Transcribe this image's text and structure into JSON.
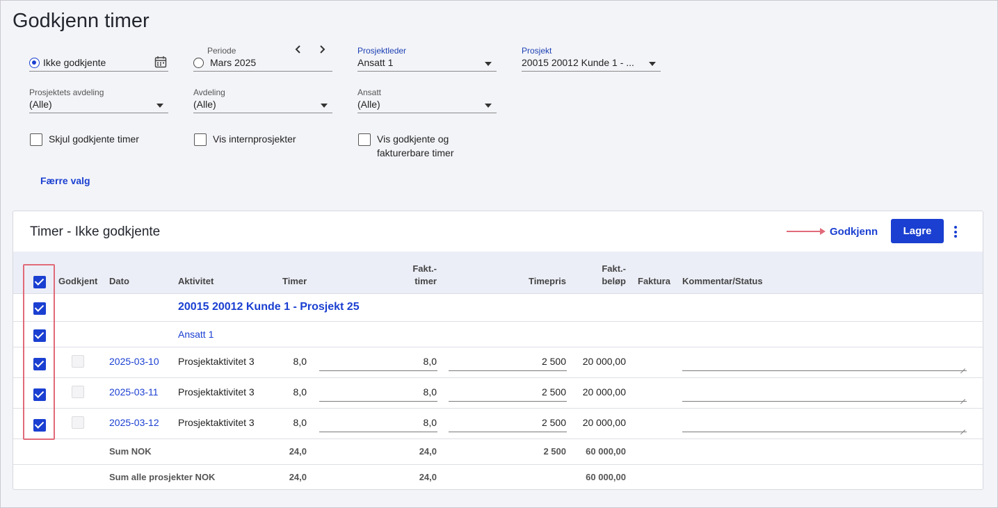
{
  "page": {
    "title": "Godkjenn timer"
  },
  "filters": {
    "status_option": "Ikke godkjente",
    "period": {
      "label": "Periode",
      "value": "Mars 2025"
    },
    "project_manager": {
      "label": "Prosjektleder",
      "value": "Ansatt 1"
    },
    "project": {
      "label": "Prosjekt",
      "value": "20015 20012 Kunde 1 - ..."
    },
    "project_department": {
      "label": "Prosjektets avdeling",
      "value": "(Alle)"
    },
    "department": {
      "label": "Avdeling",
      "value": "(Alle)"
    },
    "employee": {
      "label": "Ansatt",
      "value": "(Alle)"
    },
    "checkboxes": {
      "hide_approved": "Skjul godkjente timer",
      "show_internal": "Vis internprosjekter",
      "show_approved_billable_line1": "Vis godkjente og",
      "show_approved_billable_line2": "fakturerbare timer"
    },
    "fewer_options": "Færre valg"
  },
  "panel": {
    "title": "Timer - Ikke godkjente",
    "approve_label": "Godkjenn",
    "save_label": "Lagre"
  },
  "table": {
    "headers": {
      "approved": "Godkjent",
      "date": "Dato",
      "activity": "Aktivitet",
      "hours": "Timer",
      "billable_hours_1": "Fakt.-",
      "billable_hours_2": "timer",
      "rate": "Timepris",
      "billable_amount_1": "Fakt.-",
      "billable_amount_2": "beløp",
      "invoice": "Faktura",
      "comment": "Kommentar/Status"
    },
    "project_group": "20015 20012 Kunde 1 - Prosjekt 25",
    "employee_group": "Ansatt 1",
    "rows": [
      {
        "date": "2025-03-10",
        "activity": "Prosjektaktivitet 3",
        "hours": "8,0",
        "billable_hours": "8,0",
        "rate": "2 500",
        "amount": "20 000,00"
      },
      {
        "date": "2025-03-11",
        "activity": "Prosjektaktivitet 3",
        "hours": "8,0",
        "billable_hours": "8,0",
        "rate": "2 500",
        "amount": "20 000,00"
      },
      {
        "date": "2025-03-12",
        "activity": "Prosjektaktivitet 3",
        "hours": "8,0",
        "billable_hours": "8,0",
        "rate": "2 500",
        "amount": "20 000,00"
      }
    ],
    "sum": {
      "label": "Sum NOK",
      "hours": "24,0",
      "billable_hours": "24,0",
      "rate": "2 500",
      "amount": "60 000,00"
    },
    "sum_all": {
      "label": "Sum alle prosjekter NOK",
      "hours": "24,0",
      "billable_hours": "24,0",
      "amount": "60 000,00"
    }
  },
  "colors": {
    "accent": "#1a3fd1",
    "annotation": "#e06a78"
  }
}
